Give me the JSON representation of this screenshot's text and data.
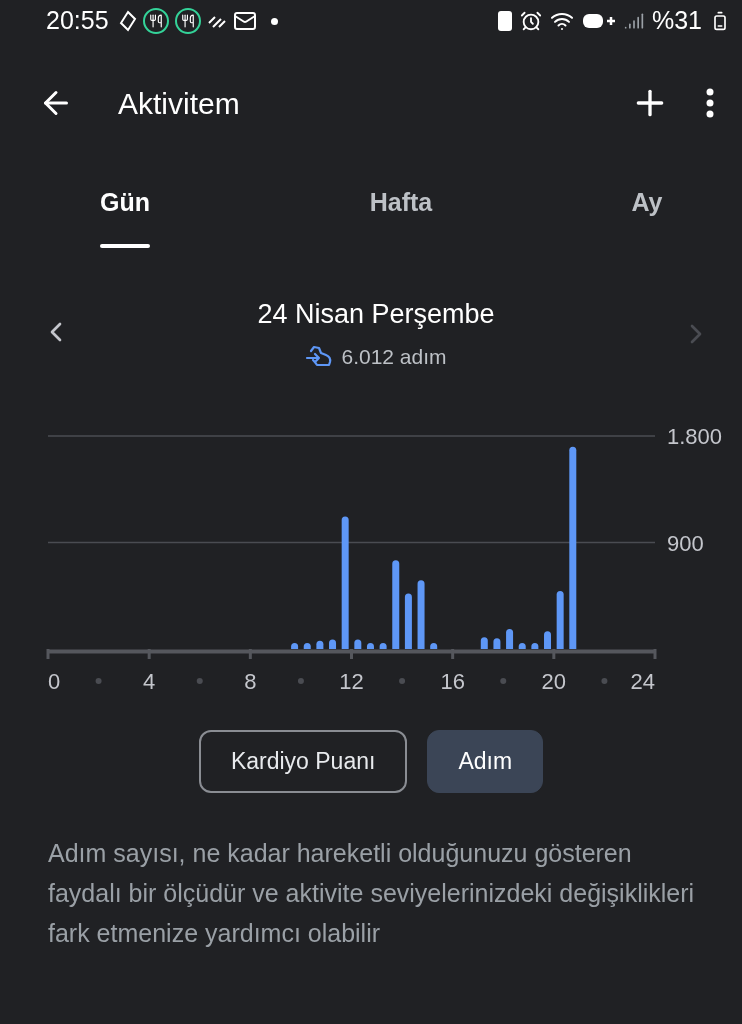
{
  "status_bar": {
    "time": "20:55",
    "battery": "%31"
  },
  "header": {
    "title": "Aktivitem"
  },
  "tabs": [
    {
      "label": "Gün",
      "selected": true
    },
    {
      "label": "Hafta",
      "selected": false
    },
    {
      "label": "Ay",
      "selected": false
    }
  ],
  "date_nav": {
    "title": "24 Nisan Perşembe",
    "steps": "6.012 adım",
    "next_disabled": true
  },
  "chart_data": {
    "type": "bar",
    "x": [
      0.25,
      0.75,
      1.25,
      1.75,
      2.25,
      2.75,
      3.25,
      3.75,
      4.25,
      4.75,
      5.25,
      5.75,
      6.25,
      6.75,
      7.25,
      7.75,
      8.25,
      8.75,
      9.25,
      9.75,
      10.25,
      10.75,
      11.25,
      11.75,
      12.25,
      12.75,
      13.25,
      13.75,
      14.25,
      14.75,
      15.25,
      15.75,
      16.25,
      16.75,
      17.25,
      17.75,
      18.25,
      18.75,
      19.25,
      19.75,
      20.25,
      20.75,
      21.25,
      21.75,
      22.25,
      22.75,
      23.25,
      23.75
    ],
    "series": [
      {
        "color": "#5e97f6",
        "values": [
          0,
          0,
          0,
          0,
          0,
          0,
          0,
          0,
          0,
          0,
          0,
          0,
          0,
          0,
          0,
          0,
          0,
          0,
          0,
          50,
          50,
          70,
          80,
          1120,
          80,
          50,
          50,
          750,
          470,
          580,
          50,
          0,
          0,
          0,
          100,
          90,
          170,
          50,
          50,
          150,
          490,
          1710,
          0,
          0,
          0,
          0,
          0,
          0
        ]
      }
    ],
    "xlim": [
      0,
      24
    ],
    "ylim": [
      0,
      1800
    ],
    "xticks": [
      0,
      4,
      8,
      12,
      16,
      20,
      24
    ],
    "yticks": [
      {
        "value": 900,
        "label": "900"
      },
      {
        "value": 1800,
        "label": "1.800"
      }
    ]
  },
  "metric_buttons": [
    {
      "label": "Kardiyo Puanı",
      "selected": false
    },
    {
      "label": "Adım",
      "selected": true
    }
  ],
  "description": "Adım sayısı, ne kadar hareketli olduğunuzu gösteren faydalı bir ölçüdür ve aktivite seviyelerinizdeki değişiklikleri fark etmenize yardımcı olabilir"
}
